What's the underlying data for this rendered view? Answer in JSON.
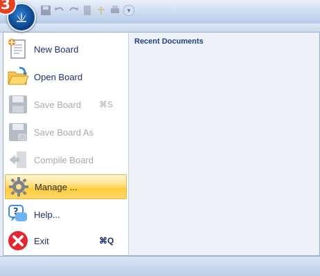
{
  "step_badge": "3",
  "recent": {
    "title": "Recent Documents"
  },
  "menu": {
    "items": [
      {
        "label": "New Board",
        "shortcut": "",
        "enabled": true,
        "active": false,
        "icon": "new-document-icon"
      },
      {
        "label": "Open Board",
        "shortcut": "",
        "enabled": true,
        "active": false,
        "icon": "open-folder-icon"
      },
      {
        "label": "Save Board",
        "shortcut": "⌘S",
        "enabled": false,
        "active": false,
        "icon": "floppy-disk-icon"
      },
      {
        "label": "Save Board As",
        "shortcut": "",
        "enabled": false,
        "active": false,
        "icon": "floppy-disk-as-icon"
      },
      {
        "label": "Compile Board",
        "shortcut": "",
        "enabled": false,
        "active": false,
        "icon": "compile-icon"
      },
      {
        "label": "Manage ...",
        "shortcut": "",
        "enabled": true,
        "active": true,
        "icon": "gear-icon"
      },
      {
        "label": "Help...",
        "shortcut": "",
        "enabled": true,
        "active": false,
        "icon": "help-icon"
      },
      {
        "label": "Exit",
        "shortcut": "⌘Q",
        "enabled": true,
        "active": false,
        "icon": "exit-icon"
      }
    ]
  },
  "colors": {
    "accent": "#1d2f6e",
    "highlight": "#ffcd3b",
    "badge": "#e8401f"
  }
}
